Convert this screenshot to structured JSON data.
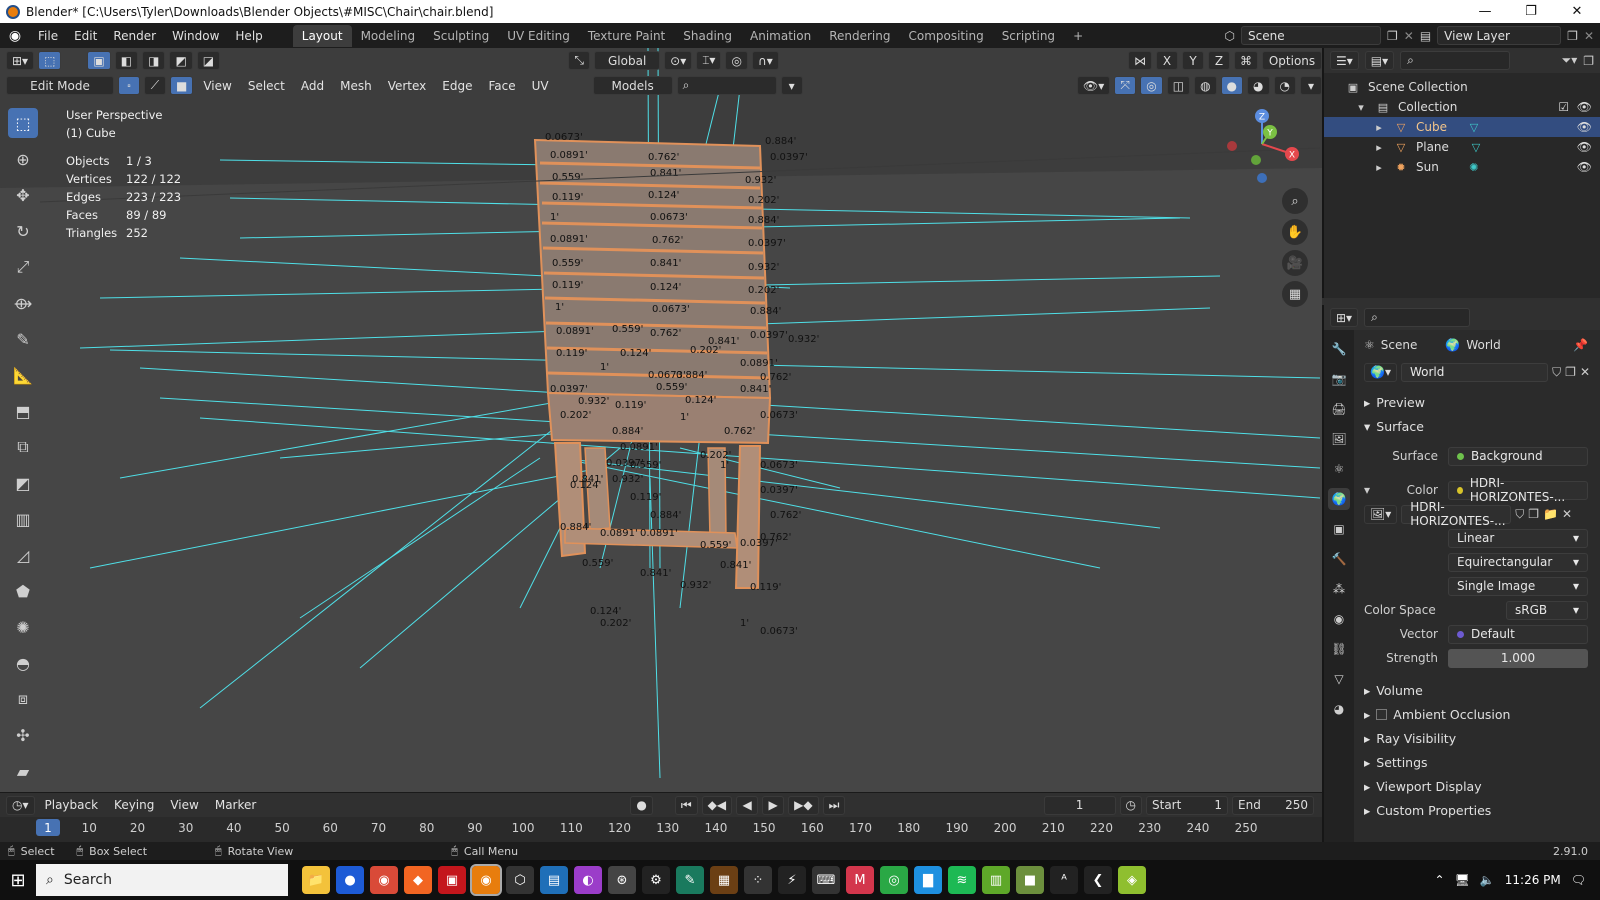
{
  "window": {
    "title": "Blender* [C:\\Users\\Tyler\\Downloads\\Blender Objects\\#MISC\\Chair\\chair.blend]",
    "min_icon": "—",
    "max_icon": "❐",
    "close_icon": "✕"
  },
  "menu": [
    "File",
    "Edit",
    "Render",
    "Window",
    "Help"
  ],
  "workspaces": [
    "Layout",
    "Modeling",
    "Sculpting",
    "UV Editing",
    "Texture Paint",
    "Shading",
    "Animation",
    "Rendering",
    "Compositing",
    "Scripting"
  ],
  "add_workspace": "+",
  "scene_name": "Scene",
  "view_layer": "View Layer",
  "viewport": {
    "mode": "Edit Mode",
    "menus": [
      "View",
      "Select",
      "Add",
      "Mesh",
      "Vertex",
      "Edge",
      "Face",
      "UV"
    ],
    "orientation": "Global",
    "options_label": "Options",
    "axes": [
      "X",
      "Y",
      "Z"
    ],
    "layer_filter": "Models",
    "info": {
      "perspective": "User Perspective",
      "object": "(1) Cube",
      "stats": [
        {
          "label": "Objects",
          "value": "1 / 3"
        },
        {
          "label": "Vertices",
          "value": "122 / 122"
        },
        {
          "label": "Edges",
          "value": "223 / 223"
        },
        {
          "label": "Faces",
          "value": "89 / 89"
        },
        {
          "label": "Triangles",
          "value": "252"
        }
      ]
    },
    "gizmo_axes": [
      "X",
      "Y",
      "Z"
    ],
    "edge_labels": [
      "0.0673'",
      "0.884'",
      "0.0891'",
      "0.762'",
      "0.0397'",
      "0.559'",
      "0.841'",
      "0.932'",
      "0.119'",
      "0.124'",
      "0.202'",
      "1'"
    ]
  },
  "timeline": {
    "menus": [
      "Playback",
      "Keying",
      "View",
      "Marker"
    ],
    "current_frame": "1",
    "start_label": "Start",
    "start": "1",
    "end_label": "End",
    "end": "250",
    "ticks": [
      "1",
      "10",
      "20",
      "30",
      "40",
      "50",
      "60",
      "70",
      "80",
      "90",
      "100",
      "110",
      "120",
      "130",
      "140",
      "150",
      "160",
      "170",
      "180",
      "190",
      "200",
      "210",
      "220",
      "230",
      "240",
      "250"
    ]
  },
  "statusbar": {
    "select": "Select",
    "box_select": "Box Select",
    "rotate_view": "Rotate View",
    "call_menu": "Call Menu",
    "version": "2.91.0"
  },
  "outliner": {
    "root": "Scene Collection",
    "collection": "Collection",
    "items": [
      {
        "name": "Cube",
        "type": "mesh",
        "selected": true
      },
      {
        "name": "Plane",
        "type": "mesh",
        "selected": false
      },
      {
        "name": "Sun",
        "type": "light",
        "selected": false
      }
    ]
  },
  "properties": {
    "breadcrumb_scene": "Scene",
    "breadcrumb_world": "World",
    "world_name": "World",
    "sections": {
      "preview": "Preview",
      "surface": "Surface",
      "volume": "Volume",
      "ambient_occlusion": "Ambient Occlusion",
      "ray_visibility": "Ray Visibility",
      "settings": "Settings",
      "viewport_display": "Viewport Display",
      "custom_properties": "Custom Properties"
    },
    "surface_label": "Surface",
    "surface_value": "Background",
    "color_label": "Color",
    "color_value": "HDRI-HORIZONTES-...",
    "image_name": "HDRI-HORIZONTES-...",
    "interpolation": "Linear",
    "projection": "Equirectangular",
    "source": "Single Image",
    "color_space_label": "Color Space",
    "color_space": "sRGB",
    "vector_label": "Vector",
    "vector": "Default",
    "strength_label": "Strength",
    "strength": "1.000"
  },
  "taskbar": {
    "search_placeholder": "Search",
    "time": "11:26 PM"
  },
  "colors": {
    "accent": "#4772b3",
    "header": "#1d1d1d",
    "viewport_bg": "#3d3d3d",
    "wire_cyan": "#4fe0e8",
    "chair_orange": "#e0915a"
  }
}
